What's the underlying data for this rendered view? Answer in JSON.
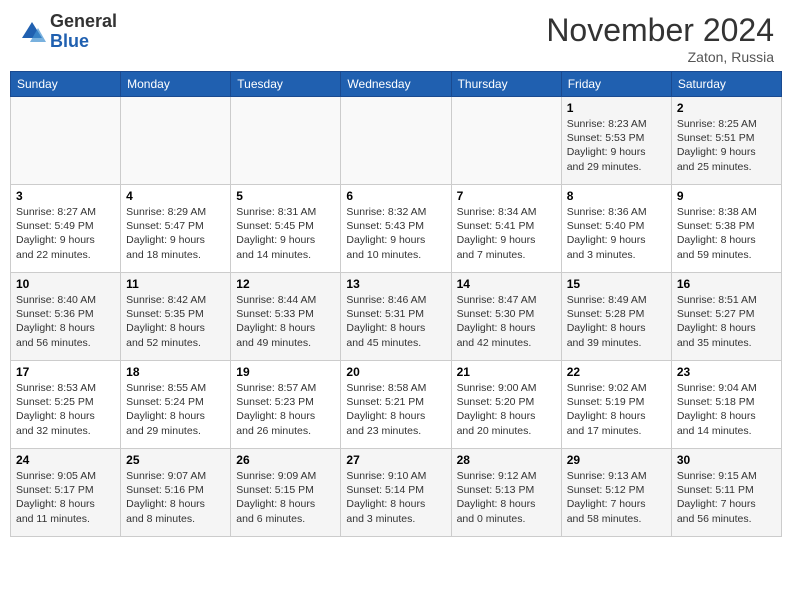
{
  "header": {
    "logo_general": "General",
    "logo_blue": "Blue",
    "month_title": "November 2024",
    "location": "Zaton, Russia"
  },
  "days_of_week": [
    "Sunday",
    "Monday",
    "Tuesday",
    "Wednesday",
    "Thursday",
    "Friday",
    "Saturday"
  ],
  "weeks": [
    [
      {
        "day": "",
        "info": ""
      },
      {
        "day": "",
        "info": ""
      },
      {
        "day": "",
        "info": ""
      },
      {
        "day": "",
        "info": ""
      },
      {
        "day": "",
        "info": ""
      },
      {
        "day": "1",
        "info": "Sunrise: 8:23 AM\nSunset: 5:53 PM\nDaylight: 9 hours\nand 29 minutes."
      },
      {
        "day": "2",
        "info": "Sunrise: 8:25 AM\nSunset: 5:51 PM\nDaylight: 9 hours\nand 25 minutes."
      }
    ],
    [
      {
        "day": "3",
        "info": "Sunrise: 8:27 AM\nSunset: 5:49 PM\nDaylight: 9 hours\nand 22 minutes."
      },
      {
        "day": "4",
        "info": "Sunrise: 8:29 AM\nSunset: 5:47 PM\nDaylight: 9 hours\nand 18 minutes."
      },
      {
        "day": "5",
        "info": "Sunrise: 8:31 AM\nSunset: 5:45 PM\nDaylight: 9 hours\nand 14 minutes."
      },
      {
        "day": "6",
        "info": "Sunrise: 8:32 AM\nSunset: 5:43 PM\nDaylight: 9 hours\nand 10 minutes."
      },
      {
        "day": "7",
        "info": "Sunrise: 8:34 AM\nSunset: 5:41 PM\nDaylight: 9 hours\nand 7 minutes."
      },
      {
        "day": "8",
        "info": "Sunrise: 8:36 AM\nSunset: 5:40 PM\nDaylight: 9 hours\nand 3 minutes."
      },
      {
        "day": "9",
        "info": "Sunrise: 8:38 AM\nSunset: 5:38 PM\nDaylight: 8 hours\nand 59 minutes."
      }
    ],
    [
      {
        "day": "10",
        "info": "Sunrise: 8:40 AM\nSunset: 5:36 PM\nDaylight: 8 hours\nand 56 minutes."
      },
      {
        "day": "11",
        "info": "Sunrise: 8:42 AM\nSunset: 5:35 PM\nDaylight: 8 hours\nand 52 minutes."
      },
      {
        "day": "12",
        "info": "Sunrise: 8:44 AM\nSunset: 5:33 PM\nDaylight: 8 hours\nand 49 minutes."
      },
      {
        "day": "13",
        "info": "Sunrise: 8:46 AM\nSunset: 5:31 PM\nDaylight: 8 hours\nand 45 minutes."
      },
      {
        "day": "14",
        "info": "Sunrise: 8:47 AM\nSunset: 5:30 PM\nDaylight: 8 hours\nand 42 minutes."
      },
      {
        "day": "15",
        "info": "Sunrise: 8:49 AM\nSunset: 5:28 PM\nDaylight: 8 hours\nand 39 minutes."
      },
      {
        "day": "16",
        "info": "Sunrise: 8:51 AM\nSunset: 5:27 PM\nDaylight: 8 hours\nand 35 minutes."
      }
    ],
    [
      {
        "day": "17",
        "info": "Sunrise: 8:53 AM\nSunset: 5:25 PM\nDaylight: 8 hours\nand 32 minutes."
      },
      {
        "day": "18",
        "info": "Sunrise: 8:55 AM\nSunset: 5:24 PM\nDaylight: 8 hours\nand 29 minutes."
      },
      {
        "day": "19",
        "info": "Sunrise: 8:57 AM\nSunset: 5:23 PM\nDaylight: 8 hours\nand 26 minutes."
      },
      {
        "day": "20",
        "info": "Sunrise: 8:58 AM\nSunset: 5:21 PM\nDaylight: 8 hours\nand 23 minutes."
      },
      {
        "day": "21",
        "info": "Sunrise: 9:00 AM\nSunset: 5:20 PM\nDaylight: 8 hours\nand 20 minutes."
      },
      {
        "day": "22",
        "info": "Sunrise: 9:02 AM\nSunset: 5:19 PM\nDaylight: 8 hours\nand 17 minutes."
      },
      {
        "day": "23",
        "info": "Sunrise: 9:04 AM\nSunset: 5:18 PM\nDaylight: 8 hours\nand 14 minutes."
      }
    ],
    [
      {
        "day": "24",
        "info": "Sunrise: 9:05 AM\nSunset: 5:17 PM\nDaylight: 8 hours\nand 11 minutes."
      },
      {
        "day": "25",
        "info": "Sunrise: 9:07 AM\nSunset: 5:16 PM\nDaylight: 8 hours\nand 8 minutes."
      },
      {
        "day": "26",
        "info": "Sunrise: 9:09 AM\nSunset: 5:15 PM\nDaylight: 8 hours\nand 6 minutes."
      },
      {
        "day": "27",
        "info": "Sunrise: 9:10 AM\nSunset: 5:14 PM\nDaylight: 8 hours\nand 3 minutes."
      },
      {
        "day": "28",
        "info": "Sunrise: 9:12 AM\nSunset: 5:13 PM\nDaylight: 8 hours\nand 0 minutes."
      },
      {
        "day": "29",
        "info": "Sunrise: 9:13 AM\nSunset: 5:12 PM\nDaylight: 7 hours\nand 58 minutes."
      },
      {
        "day": "30",
        "info": "Sunrise: 9:15 AM\nSunset: 5:11 PM\nDaylight: 7 hours\nand 56 minutes."
      }
    ]
  ]
}
